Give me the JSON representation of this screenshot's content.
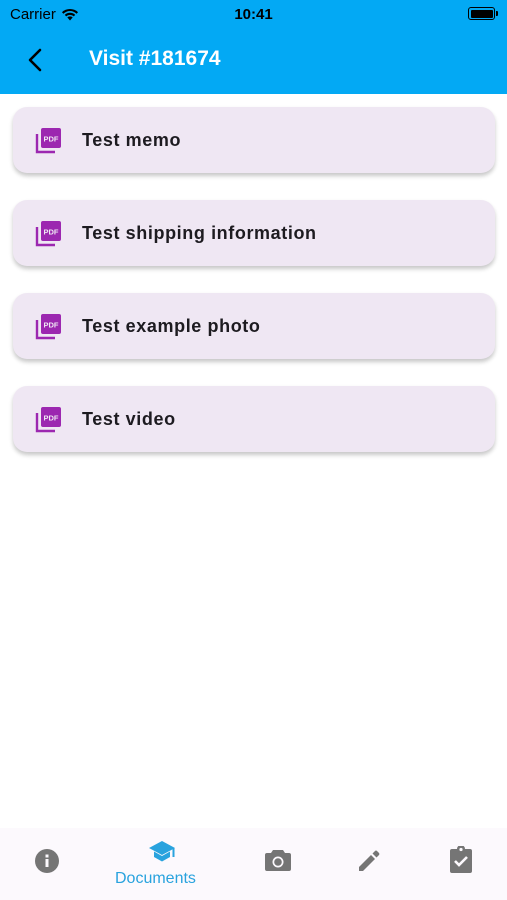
{
  "status_bar": {
    "carrier": "Carrier",
    "time": "10:41"
  },
  "appbar": {
    "title": "Visit #181674",
    "back_icon": "arrow-back-icon"
  },
  "documents": [
    {
      "label": "Test memo",
      "icon": "pdf-icon"
    },
    {
      "label": "Test shipping information",
      "icon": "pdf-icon"
    },
    {
      "label": "Test example photo",
      "icon": "pdf-icon"
    },
    {
      "label": "Test video",
      "icon": "pdf-icon"
    }
  ],
  "bottom_nav": {
    "active": "documents",
    "items": [
      {
        "icon": "info-icon",
        "label": ""
      },
      {
        "icon": "school-icon",
        "label": "Documents"
      },
      {
        "icon": "camera-icon",
        "label": ""
      },
      {
        "icon": "pencil-icon",
        "label": ""
      },
      {
        "icon": "clipboard-check-icon",
        "label": ""
      }
    ]
  },
  "colors": {
    "primary": "#03a9f4",
    "card_bg": "#efe7f3",
    "pdf_icon": "#9c27b0",
    "nav_active": "#29a3de",
    "nav_inactive": "#757575"
  }
}
